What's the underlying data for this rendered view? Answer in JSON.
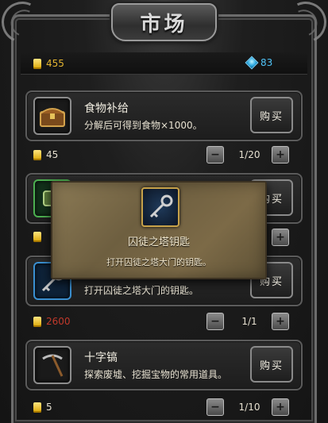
{
  "window": {
    "title": "市场"
  },
  "currency": {
    "gold": "455",
    "gems": "83"
  },
  "items": [
    {
      "name": "食物补给",
      "desc": "分解后可得到食物×1000。",
      "buy_label": "购买",
      "price": "45",
      "count": "1/20",
      "icon": "treasure-chest-icon"
    },
    {
      "name": "",
      "desc": "",
      "buy_label": "购买",
      "price": "",
      "count": "",
      "icon": "green-item-icon"
    },
    {
      "name": "",
      "desc": "打开囚徒之塔大门的钥匙。",
      "buy_label": "购买",
      "price": "2600",
      "count": "1/1",
      "icon": "key-icon"
    },
    {
      "name": "十字镐",
      "desc": "探索废墟、挖掘宝物的常用道具。",
      "buy_label": "购买",
      "price": "5",
      "count": "1/10",
      "icon": "pickaxe-icon"
    }
  ],
  "tooltip": {
    "name": "囚徒之塔钥匙",
    "desc": "打开囚徒之塔大门的钥匙。",
    "icon": "key-icon"
  },
  "colors": {
    "gold": "#e4b530",
    "gem": "#4fc3f7",
    "price_red": "#c0392b",
    "parchment": "#7c6a47"
  }
}
